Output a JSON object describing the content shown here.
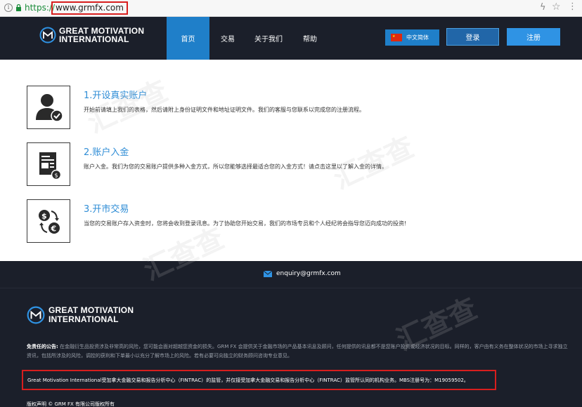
{
  "browser": {
    "scheme": "https://",
    "url": "www.grmfx.com"
  },
  "header": {
    "logo_line1": "GREAT MOTIVATION",
    "logo_line2": "INTERNATIONAL",
    "nav": [
      "首页",
      "交易",
      "关于我们",
      "帮助"
    ],
    "language": "中文简体",
    "login": "登录",
    "register": "注册"
  },
  "steps": [
    {
      "title": "1.开设真实账户",
      "desc": "开始前请填上我们的表格，然后请附上身份证明文件和地址证明文件。我们的客服与您联系以完成您的注册流程。",
      "icon": "user-check-icon"
    },
    {
      "title": "2.账户入金",
      "desc": "账户入金。我们为您的交易账户提供多种入金方式，所以您能够选择最适合您的入金方式！请点击这里以了解入金的详情。",
      "icon": "document-deposit-icon"
    },
    {
      "title": "3.开市交易",
      "desc": "当您的交易账户存入资金时，您将会收到登录讯息。为了协助您开始交易，我们的市场专员和个人经纪将会指导您迈向成功的投资!",
      "icon": "currency-exchange-icon"
    }
  ],
  "footer": {
    "email": "enquiry@grmfx.com",
    "logo_line1": "GREAT MOTIVATION",
    "logo_line2": "INTERNATIONAL",
    "disclaimer_label": "免责任的公告:",
    "disclaimer_text": "在金融衍生品投资涉及非常高的风险，您可能会面对超越您资金的损失。GRM FX 会提供关于金融市场的产品基本讯息及顾问，任何提供的讯息都不是您账户投资或经济状况的目标。同样的，客户由有义务在整体状况的市场上寻求独立资讯，包括所涉及的风险，调控的获利和下单最小以充分了解市场上的风险。若有必要可向独立的财务顾问咨询专业意见。",
    "registration": "Great Motivation International受加拿大金融交易和报告分析中心（FINTRAC）的监管，并仅接受加拿大金融交易和报告分析中心（FINTRAC）监管所认同的机构业务。MBS注册号为：M19059502。",
    "copyright": "版权声明 © GRM FX 有限公司版权所有"
  },
  "colors": {
    "header_bg": "#1b1f2a",
    "accent": "#1f7fc9",
    "highlight_box": "#d81e1e",
    "step_title": "#2f8dd6"
  }
}
